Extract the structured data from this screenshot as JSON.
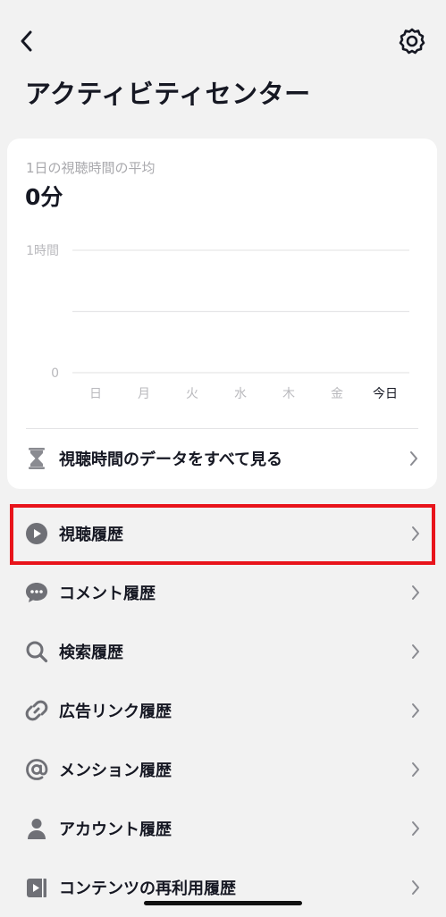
{
  "header": {
    "title": "アクティビティセンター"
  },
  "summary": {
    "label": "1日の視聴時間の平均",
    "value": "0分"
  },
  "chart_data": {
    "type": "bar",
    "categories": [
      "日",
      "月",
      "火",
      "水",
      "木",
      "金",
      "今日"
    ],
    "values": [
      0,
      0,
      0,
      0,
      0,
      0,
      0
    ],
    "ytick_labels": [
      "1時間",
      "0"
    ],
    "ylim": [
      0,
      60
    ],
    "grid": true,
    "title": "",
    "xlabel": "",
    "ylabel": ""
  },
  "card_link": {
    "label": "視聴時間のデータをすべて見る",
    "icon": "hourglass-icon"
  },
  "menu": [
    {
      "label": "視聴履歴",
      "icon": "play-circle-icon"
    },
    {
      "label": "コメント履歴",
      "icon": "comment-bubble-icon"
    },
    {
      "label": "検索履歴",
      "icon": "search-icon"
    },
    {
      "label": "広告リンク履歴",
      "icon": "link-icon"
    },
    {
      "label": "メンション履歴",
      "icon": "at-sign-icon"
    },
    {
      "label": "アカウント履歴",
      "icon": "person-icon"
    },
    {
      "label": "コンテンツの再利用履歴",
      "icon": "video-reuse-icon"
    }
  ],
  "colors": {
    "background": "#f2f2f2",
    "card": "#ffffff",
    "highlight": "#e8141b",
    "text": "#161823",
    "muted": "#a9a9ad"
  }
}
